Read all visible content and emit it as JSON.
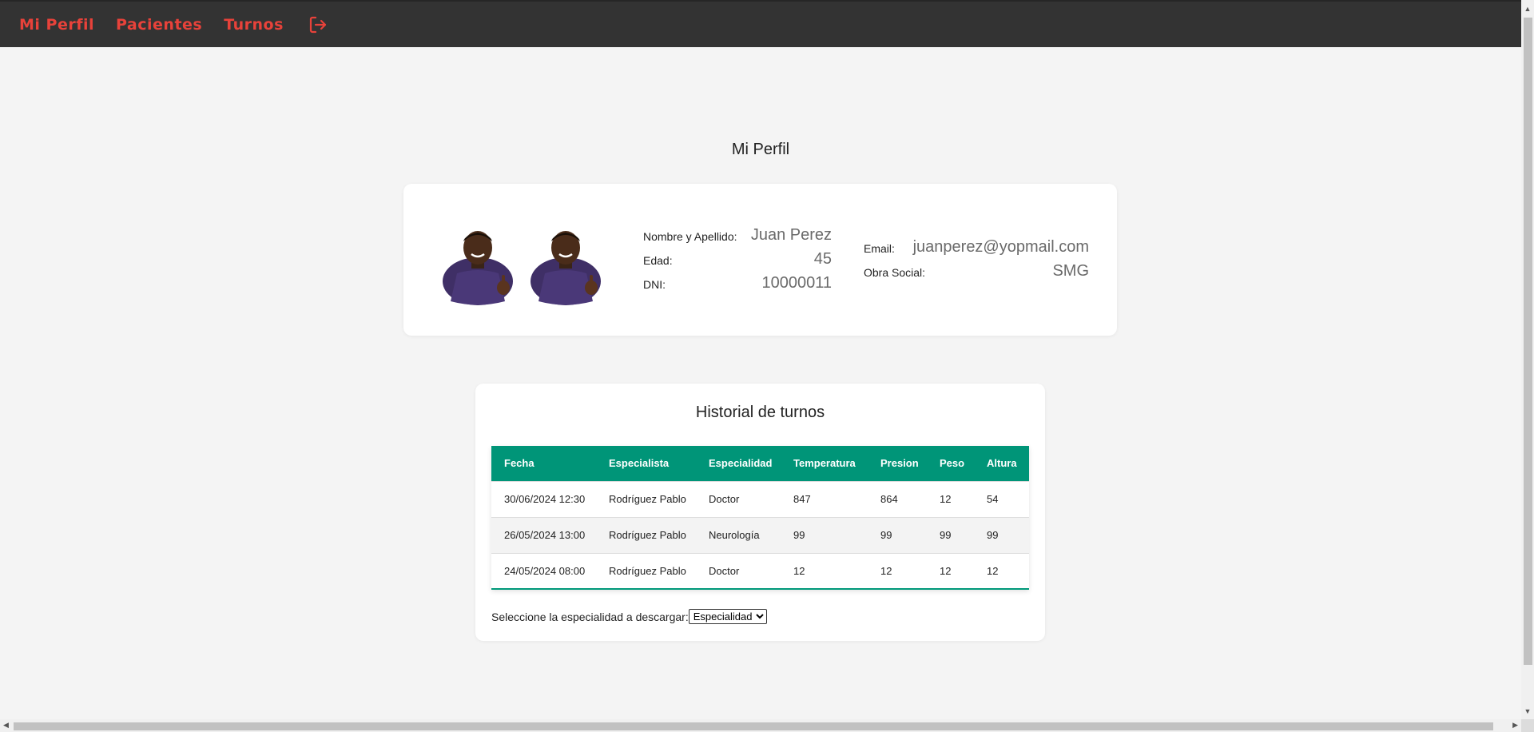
{
  "nav": {
    "links": [
      {
        "label": "Mi Perfil"
      },
      {
        "label": "Pacientes"
      },
      {
        "label": "Turnos"
      }
    ],
    "logout_icon": "logout-icon",
    "accent": "#e8423a",
    "bar_color": "#333333"
  },
  "page": {
    "title": "Mi Perfil"
  },
  "profile": {
    "images": [
      "profile-photo",
      "profile-photo"
    ],
    "name_label": "Nombre y Apellido:",
    "name": "Juan Perez",
    "age_label": "Edad:",
    "age": "45",
    "dni_label": "DNI:",
    "dni": "10000011",
    "email_label": "Email:",
    "email": "juanperez@yopmail.com",
    "insurance_label": "Obra Social:",
    "insurance": "SMG"
  },
  "history": {
    "title": "Historial de turnos",
    "header_color": "#009578",
    "columns": [
      "Fecha",
      "Especialista",
      "Especialidad",
      "Temperatura",
      "Presion",
      "Peso",
      "Altura"
    ],
    "rows": [
      [
        "30/06/2024 12:30",
        "Rodríguez Pablo",
        "Doctor",
        "847",
        "864",
        "12",
        "54"
      ],
      [
        "26/05/2024 13:00",
        "Rodríguez Pablo",
        "Neurología",
        "99",
        "99",
        "99",
        "99"
      ],
      [
        "24/05/2024 08:00",
        "Rodríguez Pablo",
        "Doctor",
        "12",
        "12",
        "12",
        "12"
      ]
    ],
    "download_label": "Seleccione la especialidad a descargar:",
    "download_select": "Especialidad"
  }
}
